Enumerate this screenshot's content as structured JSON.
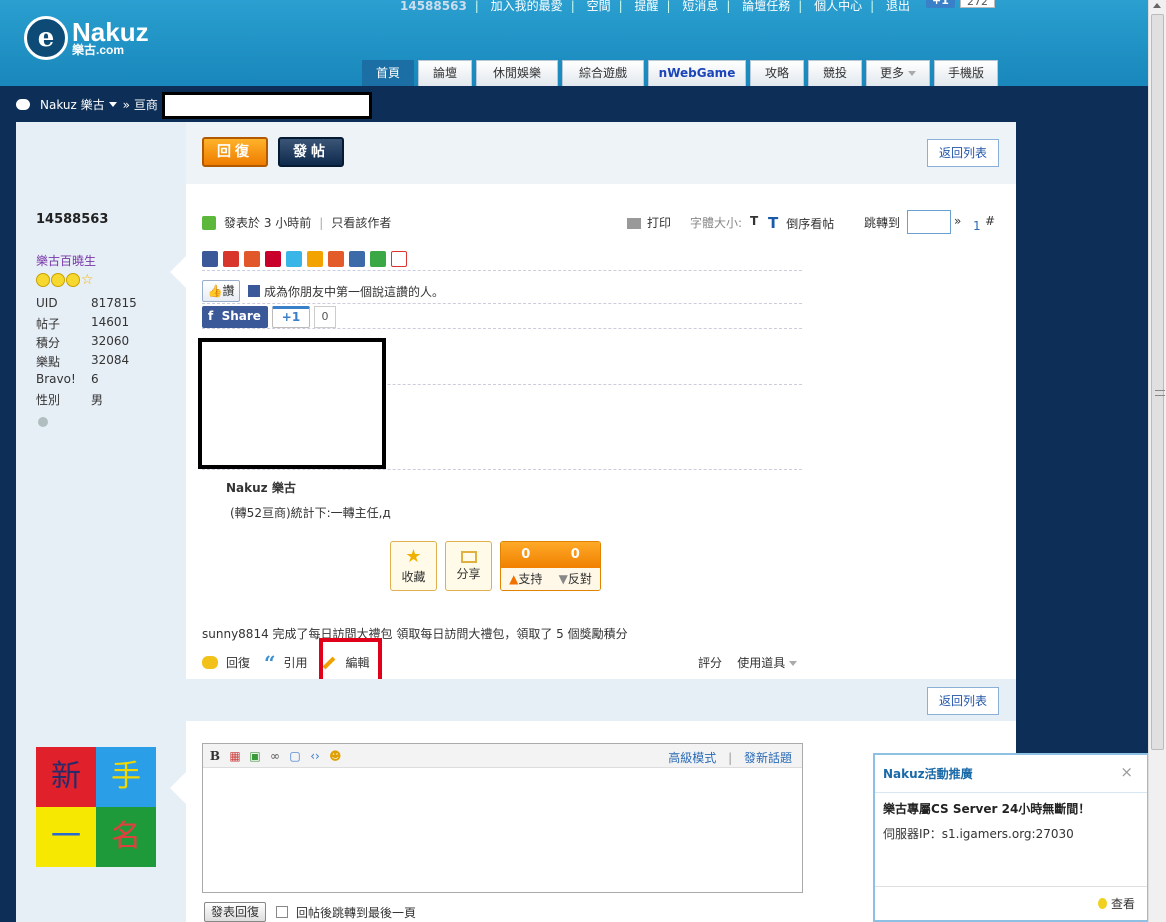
{
  "header": {
    "logo_mark": "e",
    "logo_name": "Nakuz",
    "logo_sub": "樂古.com",
    "top_user": "14588563",
    "top_links": [
      "加入我的最愛",
      "空間",
      "提醒",
      "短消息",
      "論壇任務",
      "個人中心",
      "退出"
    ],
    "gplus": "+1",
    "gcount": "272"
  },
  "nav": {
    "tabs": [
      {
        "label": "首頁",
        "active": true
      },
      {
        "label": "論壇"
      },
      {
        "label": "休閒娛樂"
      },
      {
        "label": "綜合遊戲"
      },
      {
        "label": "nWebGame"
      },
      {
        "label": "攻略"
      },
      {
        "label": "競投"
      },
      {
        "label": "更多"
      },
      {
        "label": "手機版"
      }
    ]
  },
  "breadcrumb": {
    "home": "Nakuz 樂古",
    "sep": "»",
    "section": "亘商"
  },
  "actions": {
    "reply": "回復",
    "post": "發帖",
    "back": "返回列表"
  },
  "user": {
    "name": "14588563",
    "group": "樂古百曉生",
    "stats": [
      {
        "k": "UID",
        "v": "817815"
      },
      {
        "k": "帖子",
        "v": "14601"
      },
      {
        "k": "積分",
        "v": "32060"
      },
      {
        "k": "樂點",
        "v": "32084"
      },
      {
        "k": "Bravo!",
        "v": "6"
      },
      {
        "k": "性別",
        "v": "男"
      }
    ]
  },
  "post": {
    "posted": "發表於 3 小時前",
    "only_author": "只看該作者",
    "print": "打印",
    "font_size": "字體大小:",
    "font_t": "T",
    "reverse": "倒序看帖",
    "jump": "跳轉到",
    "jump_arrow": "»",
    "page_num": "1",
    "floor": "#",
    "like": "讚",
    "like_text": "成為你朋友中第一個說這讚的人。",
    "fb_share": "Share",
    "gplus": "+1",
    "gcount": "0",
    "sig_title": "Nakuz 樂古",
    "sig_text": "(轉52亘商)統計下:一轉主任,д",
    "collect": "收藏",
    "share": "分享",
    "support_count": "0",
    "oppose_count": "0",
    "support": "支持",
    "oppose": "反對",
    "notice": "sunny8814 完成了每日訪問大禮包 領取每日訪問大禮包，領取了 5 個獎勵積分",
    "reply": "回復",
    "quote": "引用",
    "edit": "編輯",
    "rate": "評分",
    "tools": "使用道具"
  },
  "avatar": {
    "c1": "新",
    "c2": "手",
    "c3": "一",
    "c4": "名"
  },
  "editor": {
    "advanced": "高級模式",
    "sep": "|",
    "refresh": "發新話題",
    "submit": "發表回復",
    "checkbox_label": "回帖後跳轉到最後一頁"
  },
  "popup": {
    "head": "Nakuz活動推廣",
    "close": "×",
    "title": "樂古專屬CS Server 24小時無斷間！",
    "body": "伺服器IP：s1.igamers.org:27030",
    "more": "查看"
  },
  "colors": {
    "accent": "#1987bb",
    "orange": "#f08000",
    "navy": "#0d2f57"
  }
}
